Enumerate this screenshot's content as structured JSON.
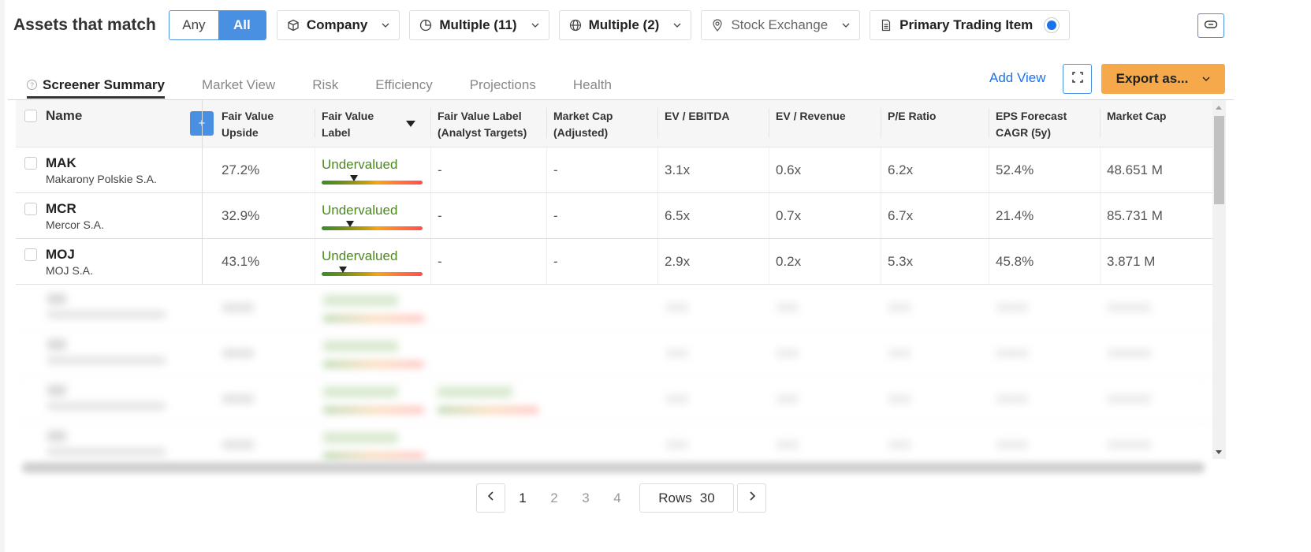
{
  "filterbar": {
    "title": "Assets that match",
    "match_mode": {
      "options": [
        "Any",
        "All"
      ],
      "selected": "All"
    },
    "filters": [
      {
        "icon": "cube-icon",
        "label": "Company",
        "muted": false
      },
      {
        "icon": "pie-chart-icon",
        "label": "Multiple (11)",
        "muted": false
      },
      {
        "icon": "globe-icon",
        "label": "Multiple (2)",
        "muted": false
      },
      {
        "icon": "location-pin-icon",
        "label": "Stock Exchange",
        "muted": true
      },
      {
        "icon": "document-icon",
        "label": "Primary Trading Item",
        "selected": true
      }
    ]
  },
  "tabs": [
    {
      "label": "Screener Summary",
      "active": true
    },
    {
      "label": "Market View"
    },
    {
      "label": "Risk"
    },
    {
      "label": "Efficiency"
    },
    {
      "label": "Projections"
    },
    {
      "label": "Health"
    }
  ],
  "actions": {
    "add_view": "Add View",
    "export": "Export as..."
  },
  "table": {
    "columns": [
      {
        "key": "name",
        "label": "Name"
      },
      {
        "key": "fv_upside",
        "label": [
          "Fair Value",
          "Upside"
        ]
      },
      {
        "key": "fv_label",
        "label": [
          "Fair Value",
          "Label"
        ],
        "sorted": "desc"
      },
      {
        "key": "fv_label_analyst",
        "label": [
          "Fair Value Label",
          "(Analyst Targets)"
        ]
      },
      {
        "key": "mcap_adj",
        "label": [
          "Market Cap",
          "(Adjusted)"
        ]
      },
      {
        "key": "ev_ebitda",
        "label": [
          "EV / EBITDA"
        ]
      },
      {
        "key": "ev_revenue",
        "label": [
          "EV / Revenue"
        ]
      },
      {
        "key": "pe",
        "label": [
          "P/E Ratio"
        ]
      },
      {
        "key": "eps_cagr",
        "label": [
          "EPS Forecast",
          "CAGR (5y)"
        ]
      },
      {
        "key": "mcap",
        "label": [
          "Market Cap"
        ]
      }
    ],
    "rows": [
      {
        "symbol": "MAK",
        "company": "Makarony Polskie S.A.",
        "fv_upside": "27.2%",
        "fv_label": "Undervalued",
        "fv_gauge": 0.32,
        "fv_label_analyst": "-",
        "mcap_adj": "-",
        "ev_ebitda": "3.1x",
        "ev_revenue": "0.6x",
        "pe": "6.2x",
        "eps_cagr": "52.4%",
        "mcap": "48.651 M"
      },
      {
        "symbol": "MCR",
        "company": "Mercor S.A.",
        "fv_upside": "32.9%",
        "fv_label": "Undervalued",
        "fv_gauge": 0.28,
        "fv_label_analyst": "-",
        "mcap_adj": "-",
        "ev_ebitda": "6.5x",
        "ev_revenue": "0.7x",
        "pe": "6.7x",
        "eps_cagr": "21.4%",
        "mcap": "85.731 M"
      },
      {
        "symbol": "MOJ",
        "company": "MOJ S.A.",
        "fv_upside": "43.1%",
        "fv_label": "Undervalued",
        "fv_gauge": 0.21,
        "fv_label_analyst": "-",
        "mcap_adj": "-",
        "ev_ebitda": "2.9x",
        "ev_revenue": "0.2x",
        "pe": "5.3x",
        "eps_cagr": "45.8%",
        "mcap": "3.871 M"
      }
    ],
    "blurred_rows": 4
  },
  "pagination": {
    "pages": [
      "1",
      "2",
      "3",
      "4"
    ],
    "current": "1",
    "rows_label": "Rows",
    "rows_value": "30"
  },
  "colors": {
    "accent": "#4a90e2",
    "link": "#1a73e8",
    "export": "#f6a94b",
    "undervalued": "#4a8a1c"
  }
}
